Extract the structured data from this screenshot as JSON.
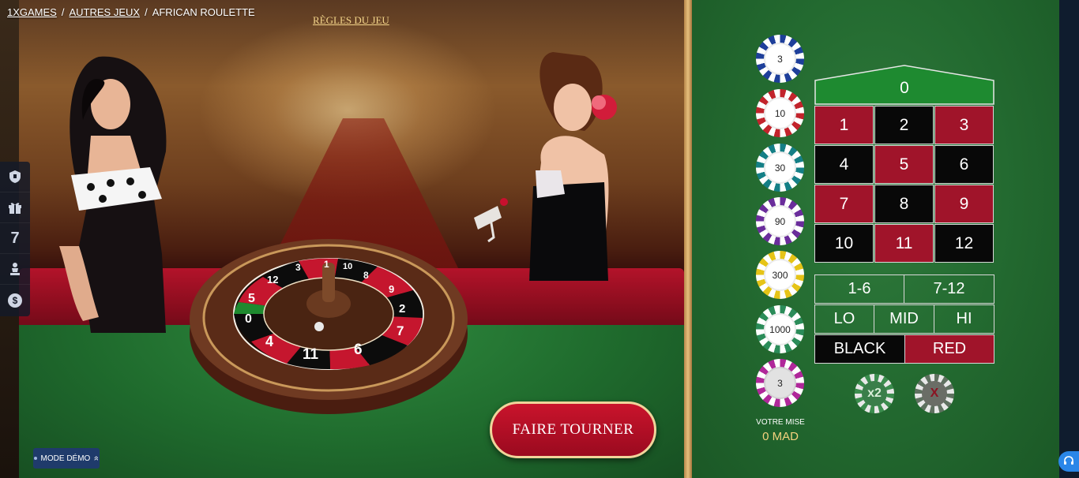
{
  "breadcrumb": {
    "items": [
      "1XGAMES",
      "AUTRES JEUX",
      "AFRICAN ROULETTE"
    ],
    "separator": "/"
  },
  "rules_link": "RÈGLES DU JEU",
  "side_dock": {
    "icons": [
      "shield-icon",
      "gift-icon",
      "seven-icon",
      "chess-piece-icon",
      "dollar-icon"
    ],
    "seven_label": "7",
    "dollar_label": "$"
  },
  "demo_mode": {
    "label": "MODE DÉMO",
    "chevron": "»"
  },
  "wheel": {
    "numbers_visible": [
      "1",
      "3",
      "12",
      "5",
      "0",
      "4",
      "11",
      "6",
      "7",
      "2",
      "9",
      "8",
      "10"
    ],
    "zero_color": "#2a8a2f"
  },
  "spin_button": "FAIRE TOURNER",
  "chips": [
    {
      "value": "3",
      "color": "#1e3f9a"
    },
    {
      "value": "10",
      "color": "#c2242c"
    },
    {
      "value": "30",
      "color": "#147f86"
    },
    {
      "value": "90",
      "color": "#6a2d9b"
    },
    {
      "value": "300",
      "color": "#e6c417"
    },
    {
      "value": "1000",
      "color": "#2b8c59"
    },
    {
      "value": "3",
      "color": "#b0289a"
    }
  ],
  "bet": {
    "label": "VOTRE MISE",
    "amount": "0 MAD"
  },
  "board": {
    "zero": "0",
    "numbers": [
      {
        "n": "1",
        "color": "red"
      },
      {
        "n": "2",
        "color": "black"
      },
      {
        "n": "3",
        "color": "red"
      },
      {
        "n": "4",
        "color": "black"
      },
      {
        "n": "5",
        "color": "red"
      },
      {
        "n": "6",
        "color": "black"
      },
      {
        "n": "7",
        "color": "red"
      },
      {
        "n": "8",
        "color": "black"
      },
      {
        "n": "9",
        "color": "red"
      },
      {
        "n": "10",
        "color": "black"
      },
      {
        "n": "11",
        "color": "red"
      },
      {
        "n": "12",
        "color": "black"
      }
    ],
    "outside": {
      "low_half": "1-6",
      "high_half": "7-12",
      "lo": "LO",
      "mid": "MID",
      "hi": "HI",
      "black": "BLACK",
      "red": "RED"
    },
    "colors": {
      "red": "#a0142a",
      "black": "#080808",
      "zero_green": "#1e8a30"
    }
  },
  "actions": {
    "double": "x2",
    "clear": "X"
  }
}
